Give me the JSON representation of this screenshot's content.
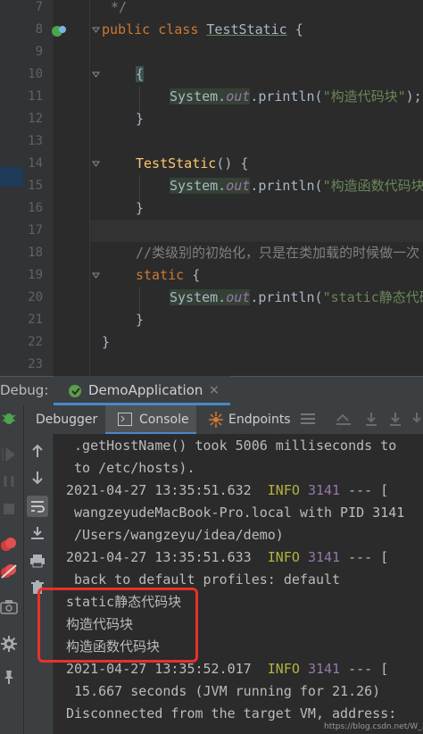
{
  "editor": {
    "line_numbers": [
      "7",
      "8",
      "9",
      "10",
      "11",
      "12",
      "13",
      "14",
      "15",
      "16",
      "17",
      "18",
      "19",
      "20",
      "21",
      "22",
      "23"
    ],
    "lines": {
      "l7": "*/",
      "l8_kw": "public class ",
      "l8_name": "TestStatic",
      "l8_end": " {",
      "l10": "{",
      "l11_sys": "System.",
      "l11_out": "out",
      "l11_call": ".println(",
      "l11_str": "\"构造代码块\"",
      "l11_end": ");",
      "l12": "}",
      "l14_name": "TestStatic",
      "l14_end": "() {",
      "l15_sys": "System.",
      "l15_out": "out",
      "l15_call": ".println(",
      "l15_str": "\"构造函数代码块\"",
      "l15_end": ");",
      "l16": "}",
      "l18": "//类级别的初始化，只是在类加载的时候做一次",
      "l19_kw": "static",
      "l19_end": " {",
      "l20_sys": "System.",
      "l20_out": "out",
      "l20_call": ".println(",
      "l20_str": "\"static静态代码块\"",
      "l20_end": ");",
      "l21": "}",
      "l22": "}"
    }
  },
  "debug": {
    "label": "Debug:",
    "run_config": "DemoApplication",
    "close": "×"
  },
  "toolbar": {
    "debugger": "Debugger",
    "console": "Console",
    "endpoints": "Endpoints"
  },
  "console": {
    "lines": [
      " .getHostName() took 5006 milliseconds to",
      " to /etc/hosts).",
      "2021-04-27 13:35:51.632  INFO 3141 --- [",
      " wangzeyudeMacBook-Pro.local with PID 3141",
      " /Users/wangzeyu/idea/demo)",
      "2021-04-27 13:35:51.633  INFO 3141 --- [",
      " back to default profiles: default",
      "static静态代码块",
      "构造代码块",
      "构造函数代码块",
      "2021-04-27 13:35:52.017  INFO 3141 --- [",
      " 15.667 seconds (JVM running for 21.26)",
      "Disconnected from the target VM, address:"
    ],
    "info_label": "INFO",
    "pid": "3141"
  },
  "watermark": "https://blog.csdn.net/W_317",
  "colors": {
    "accent": "#4a88c7",
    "highlight": "#e8322a"
  }
}
